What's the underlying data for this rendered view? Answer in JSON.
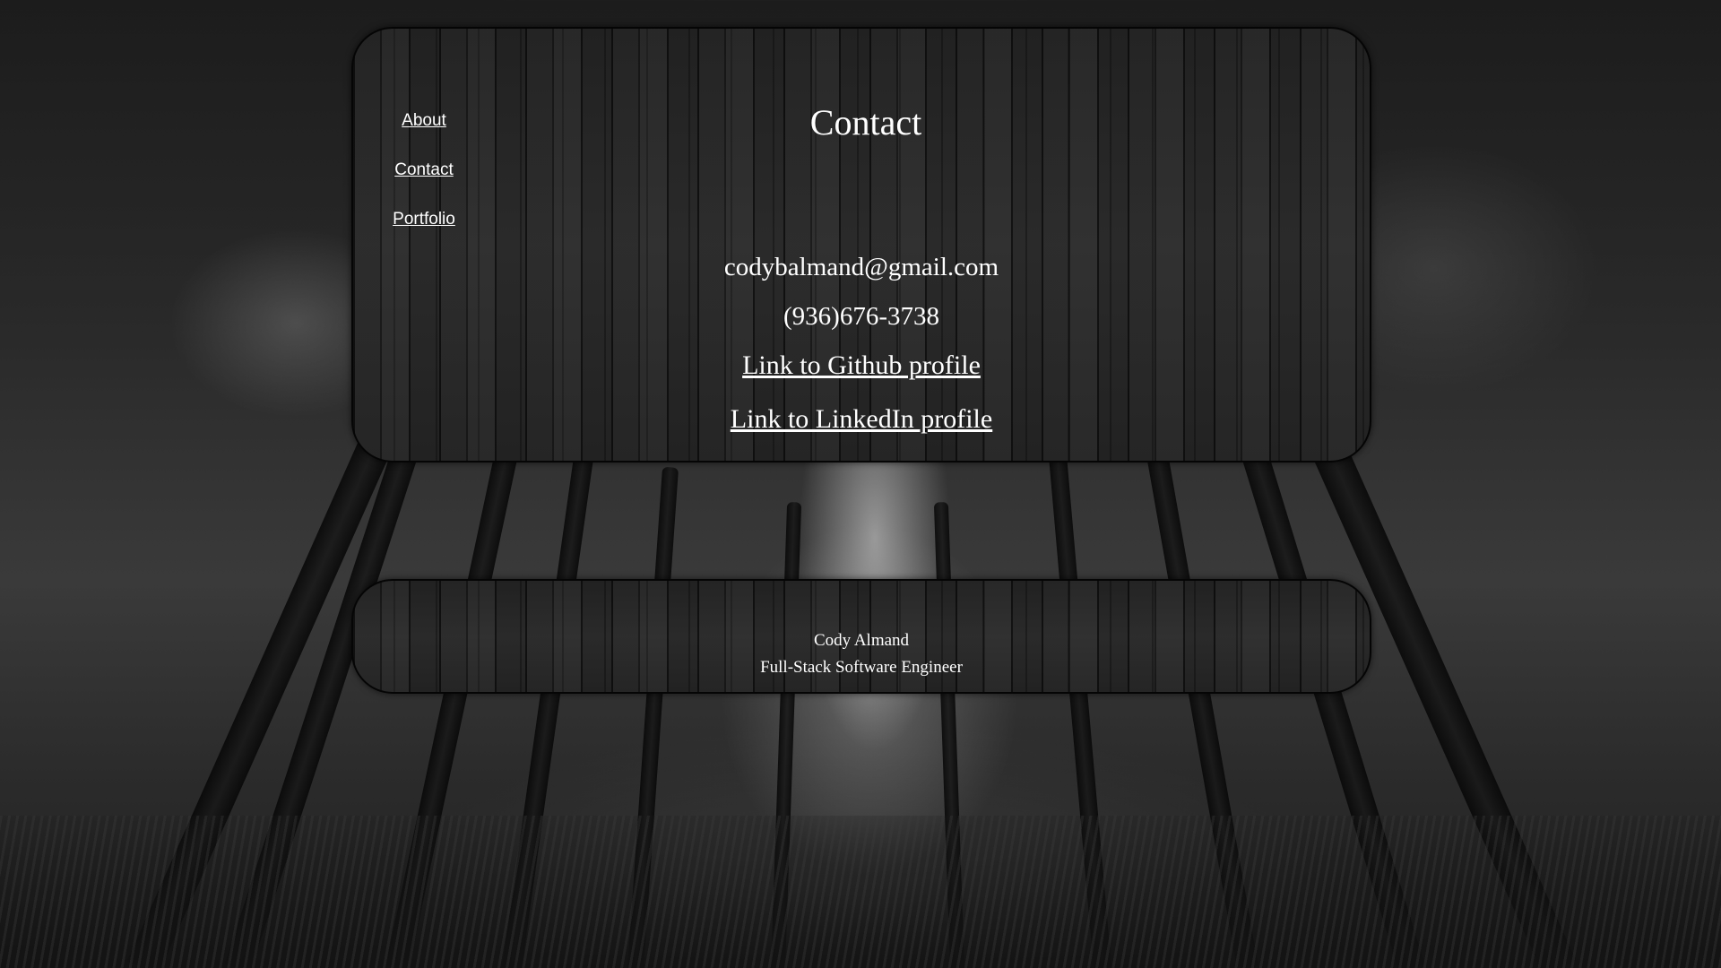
{
  "nav": {
    "items": [
      {
        "label": "About"
      },
      {
        "label": "Contact"
      },
      {
        "label": "Portfolio"
      }
    ]
  },
  "main": {
    "title": "Contact",
    "email": "codybalmand@gmail.com",
    "phone": "(936)676-3738",
    "github_link": "Link to Github profile",
    "linkedin_link": "Link to LinkedIn profile"
  },
  "footer": {
    "name": "Cody Almand",
    "role": "Full-Stack Software Engineer"
  },
  "colors": {
    "text": "#ffffff",
    "panel_border": "#050505",
    "panel_wood": "#222222"
  }
}
